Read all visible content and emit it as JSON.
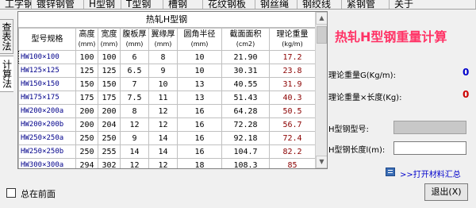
{
  "tabs": [
    "工字钢",
    "镀锌钢管",
    "H型钢",
    "T型钢",
    "槽钢",
    "花纹钢板",
    "钢丝绳",
    "钢绞线",
    "紧钢管",
    "关于"
  ],
  "side_tabs": [
    "查表法",
    "计算法"
  ],
  "grid": {
    "title": "热轧H型钢",
    "columns": [
      {
        "label": "型号规格",
        "unit": ""
      },
      {
        "label": "高度",
        "unit": "(mm)"
      },
      {
        "label": "宽度",
        "unit": "(mm)"
      },
      {
        "label": "腹板厚",
        "unit": "(mm)"
      },
      {
        "label": "翼缘厚",
        "unit": "(mm)"
      },
      {
        "label": "圆角半径",
        "unit": "(mm)"
      },
      {
        "label": "截面面积",
        "unit": "(cm2)"
      },
      {
        "label": "理论重量",
        "unit": "(kg/m)"
      }
    ],
    "rows": [
      [
        "HW100×100",
        "100",
        "100",
        "6",
        "8",
        "10",
        "21.90",
        "17.2"
      ],
      [
        "HW125×125",
        "125",
        "125",
        "6.5",
        "9",
        "10",
        "30.31",
        "23.8"
      ],
      [
        "HW150×150",
        "150",
        "150",
        "7",
        "10",
        "13",
        "40.55",
        "31.9"
      ],
      [
        "HW175×175",
        "175",
        "175",
        "7.5",
        "11",
        "13",
        "51.43",
        "40.3"
      ],
      [
        "HW200×200a",
        "200",
        "200",
        "8",
        "12",
        "16",
        "64.28",
        "50.5"
      ],
      [
        "HW200×200b",
        "200",
        "204",
        "12",
        "12",
        "16",
        "72.28",
        "56.7"
      ],
      [
        "HW250×250a",
        "250",
        "250",
        "9",
        "14",
        "16",
        "92.18",
        "72.4"
      ],
      [
        "HW250×250b",
        "250",
        "255",
        "14",
        "14",
        "16",
        "104.7",
        "82.2"
      ],
      [
        "HW300×300a",
        "294",
        "302",
        "12",
        "12",
        "18",
        "108.3",
        "85"
      ]
    ]
  },
  "calc": {
    "title": "热轧H型钢重量计算",
    "weight_label": "理论重量G(Kg/m):",
    "weight_value": "0",
    "total_label": "理论重量×长度(Kg):",
    "total_value": "0",
    "model_label": "H型钢型号:",
    "length_label": "H型钢长度l(m):",
    "length_value": "",
    "link": ">>打开材料汇总"
  },
  "bottom": {
    "always_on_top": "总在前面",
    "exit": "退出(X)"
  },
  "colors": {
    "title_red": "#ff3366",
    "weight_zero": "#0000cc",
    "total_zero": "#cc0000",
    "row_name": "#00008b",
    "row_weight": "#8b0000"
  }
}
